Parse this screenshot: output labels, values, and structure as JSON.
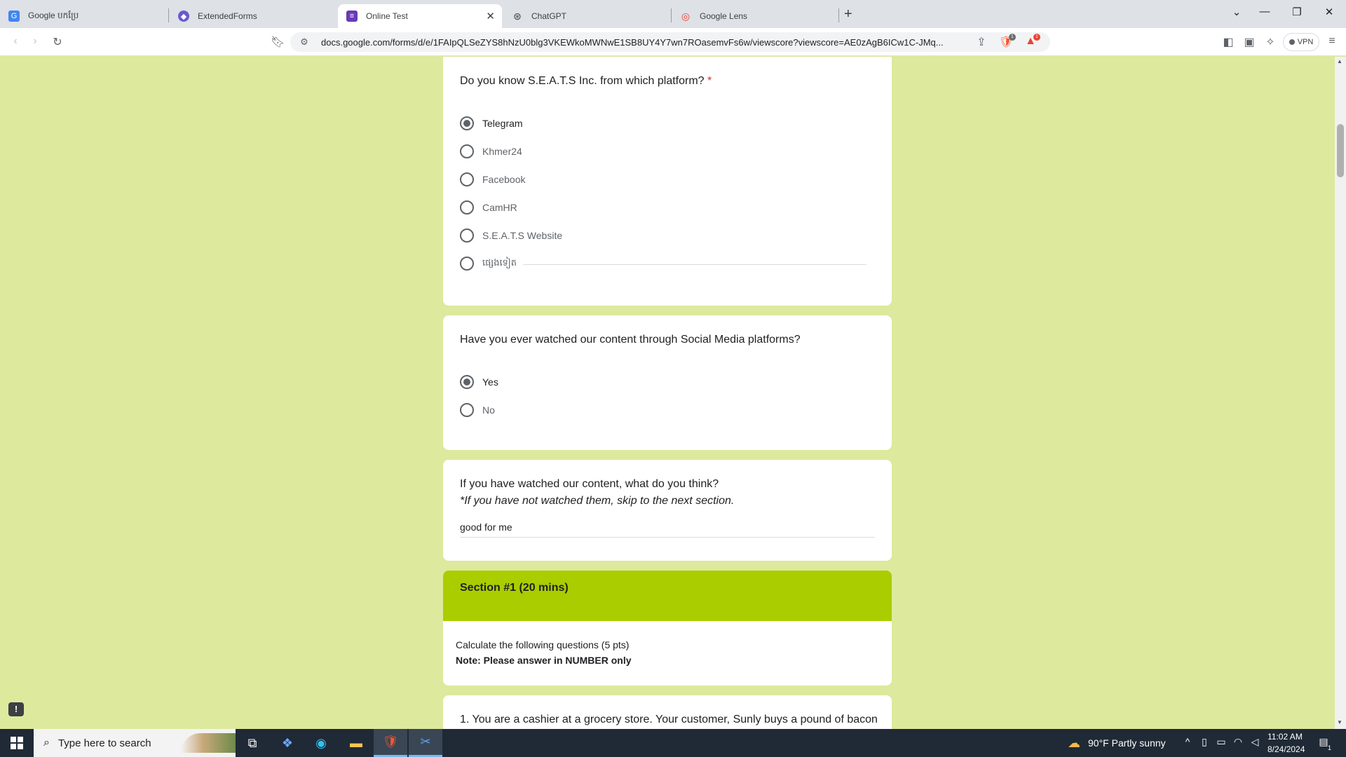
{
  "browser": {
    "tabs": [
      {
        "title": "Google បកប្រែ",
        "icon": "google-translate-icon",
        "active": false
      },
      {
        "title": "ExtendedForms",
        "icon": "extendedforms-icon",
        "active": false
      },
      {
        "title": "Online Test",
        "icon": "google-forms-icon",
        "active": true
      },
      {
        "title": "ChatGPT",
        "icon": "chatgpt-icon",
        "active": false
      },
      {
        "title": "Google Lens",
        "icon": "google-lens-icon",
        "active": false
      }
    ],
    "url": "docs.google.com/forms/d/e/1FAIpQLSeZYS8hNzU0blg3VKEWkoMWNwE1SB8UY4Y7wn7ROasemvFs6w/viewscore?viewscore=AE0zAgB6ICw1C-JMq...",
    "vpn_label": "VPN",
    "brave_badge": "1",
    "rewards_badge": "1"
  },
  "form": {
    "q1": {
      "title": "Do you know S.E.A.T.S Inc. from which platform?",
      "required_mark": "*",
      "options": [
        "Telegram",
        "Khmer24",
        "Facebook",
        "CamHR",
        "S.E.A.T.S Website",
        "ផ្សេងទៀត"
      ],
      "selected": "Telegram"
    },
    "q2": {
      "title": "Have you ever watched our content through Social Media platforms?",
      "options": [
        "Yes",
        "No"
      ],
      "selected": "Yes"
    },
    "q3": {
      "title": "If you have watched our content, what do you think?",
      "subtitle": "*If you have not watched them, skip to the next section.",
      "answer": "good for me"
    },
    "section": {
      "title": "Section #1 (20 mins)",
      "description": "Calculate the following questions (5 pts)",
      "note": "Note: Please answer in NUMBER only"
    },
    "q4": {
      "title": "1. You are a cashier at a grocery store. Your customer, Sunly buys a pound of bacon"
    }
  },
  "colors": {
    "page_bg": "#dde99c",
    "section_header": "#aacd00",
    "required": "#d93025"
  },
  "taskbar": {
    "search_placeholder": "Type here to search",
    "weather": "90°F  Partly sunny",
    "time": "11:02 AM",
    "date": "8/24/2024",
    "notification_count": "1"
  }
}
